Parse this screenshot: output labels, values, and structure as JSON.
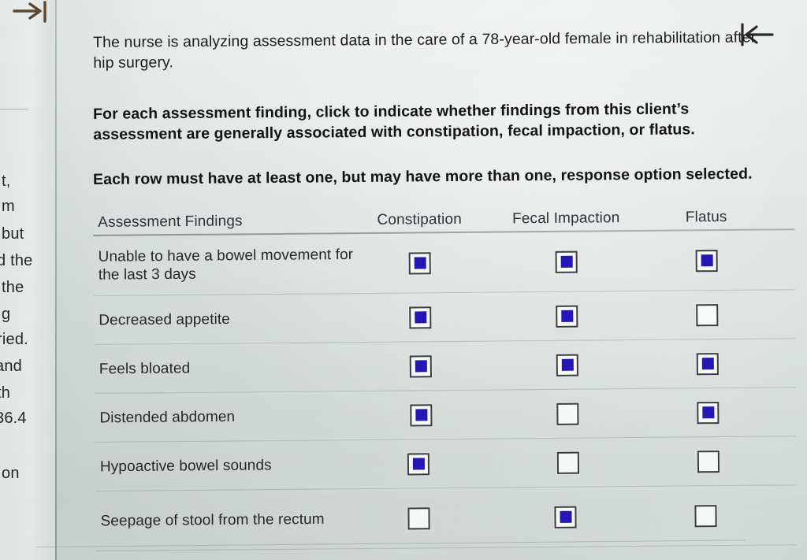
{
  "icons": {
    "jump_to_end": "jump-to-end-arrow-icon",
    "jump_to_start": "jump-to-start-arrow-icon"
  },
  "left_page_fragments": [
    "t,",
    "m",
    "but",
    "d the",
    "the",
    "g",
    "ried.",
    "and",
    "th",
    "36.4",
    "on"
  ],
  "question": {
    "stem": "The nurse is analyzing assessment data in the care of a 78-year-old female in rehabilitation after hip surgery.",
    "instruction_1": "For each assessment finding, click to indicate whether findings from this client’s assessment are generally associated with constipation, fecal impaction, or flatus.",
    "instruction_2": "Each row must have at least one, but may have more than one, response option selected."
  },
  "table": {
    "columns": [
      {
        "key": "finding",
        "label": "Assessment Findings"
      },
      {
        "key": "constipation",
        "label": "Constipation"
      },
      {
        "key": "fecal_impaction",
        "label": "Fecal Impaction"
      },
      {
        "key": "flatus",
        "label": "Flatus"
      }
    ],
    "rows": [
      {
        "finding": "Unable to have a bowel movement for the last 3 days",
        "constipation": true,
        "fecal_impaction": true,
        "flatus": true
      },
      {
        "finding": "Decreased appetite",
        "constipation": true,
        "fecal_impaction": true,
        "flatus": false
      },
      {
        "finding": "Feels bloated",
        "constipation": true,
        "fecal_impaction": true,
        "flatus": true
      },
      {
        "finding": "Distended abdomen",
        "constipation": true,
        "fecal_impaction": false,
        "flatus": true
      },
      {
        "finding": "Hypoactive bowel sounds",
        "constipation": true,
        "fecal_impaction": false,
        "flatus": false
      },
      {
        "finding": "Seepage of stool from the rectum",
        "constipation": false,
        "fecal_impaction": true,
        "flatus": false
      }
    ]
  },
  "colors": {
    "page_background": "#e2e7e5",
    "checkbox_fill": "#2318b8",
    "checkbox_border": "#3a3c40",
    "text": "#26272c",
    "rule": "#8a9694"
  }
}
